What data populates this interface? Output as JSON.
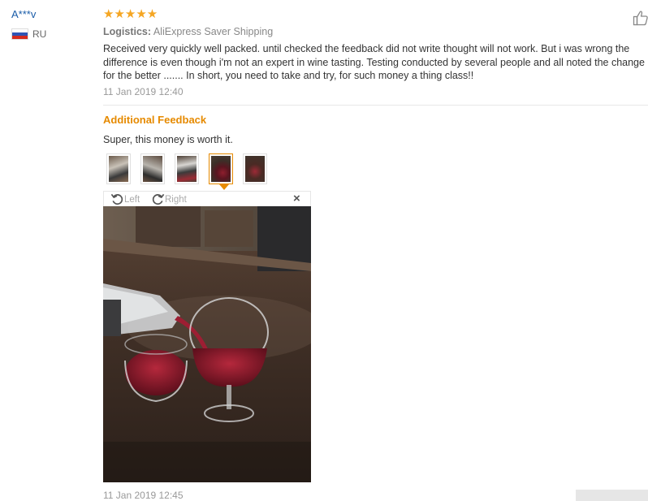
{
  "user": {
    "name": "A***v",
    "country": "RU"
  },
  "rating": {
    "stars_text": "★★★★★",
    "value": 5,
    "max": 5
  },
  "logistics": {
    "label": "Logistics:",
    "value": "AliExpress Saver Shipping"
  },
  "review": {
    "lines": [
      "Received very quickly well packed. until checked the feedback did not write thought will not work. But i was wrong the",
      "difference is even though i'm not an expert in wine tasting. Testing conducted by several people and all noted the change",
      "for the better ....... In short, you need to take and try, for such money a thing class!!"
    ],
    "date": "11 Jan 2019 12:40"
  },
  "additional": {
    "title": "Additional Feedback",
    "text": "Super, this money is worth it.",
    "date": "11 Jan 2019 12:45"
  },
  "viewer": {
    "rotate_left": "Left",
    "rotate_right": "Right",
    "close": "×",
    "thumbnail_count": 5,
    "selected_thumbnail": 4
  },
  "colors": {
    "link": "#1a5ca8",
    "star": "#f5a623",
    "accent": "#e68a00"
  },
  "icons": [
    "thumbs-up-icon",
    "rotate-left-icon",
    "rotate-right-icon",
    "close-icon",
    "flag-ru-icon"
  ]
}
